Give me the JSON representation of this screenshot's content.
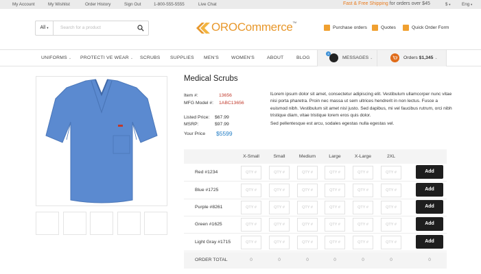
{
  "topbar": {
    "links": [
      "My Account",
      "My Wishlist",
      "Order History",
      "Sign Out",
      "1-800-555-5555",
      "Live Chat"
    ],
    "shipping_highlight": "Fast & Free Shipping",
    "shipping_rest": "for orders over $45",
    "currency": "$",
    "language": "Eng"
  },
  "header": {
    "search_scope": "All",
    "search_placeholder": "Search for a product",
    "logo_oro": "ORO",
    "logo_commerce": "Commerce",
    "logo_tm": "TM",
    "links": [
      "Purchase orders",
      "Quotes",
      "Quick Order Form"
    ]
  },
  "nav": {
    "items": [
      "UNIFORMS",
      "PROTECTI VE WEAR",
      "SCRUBS",
      "SUPPLIES",
      "MEN'S",
      "WOMEN'S",
      "ABOUT",
      "BLOG"
    ],
    "messages_label": "MESSAGES",
    "messages_count": "3",
    "orders_label": "Orders",
    "orders_amount": "$1,345"
  },
  "product": {
    "title": "Medical Scrubs",
    "item_label": "Item #:",
    "item_value": "13656",
    "mfg_label": "MFG Model #:",
    "mfg_value": "1ABC13656",
    "listed_label": "Listed Price:",
    "listed_value": "$67.99",
    "msrp_label": "MSRP:",
    "msrp_value": "$97.99",
    "your_label": "Your Price",
    "your_value": "$5599",
    "desc1": "lLorem ipsum dolor sit amet, consectetur adipiscing elit. Vestibulum ullamcorper nunc vitae nisi porta pharetra. Proin nec massa ut sem ultrices hendrerit in non lectus. Fusce a euismod nibh. Vestibulum sit amet nisl justo. Sed dapibus, mi vel faucibus rutrum, orci nibh tristique diam, vitae tristique lorem eros quis dolor.",
    "desc2": "Sed pellentesque est arcu, sodales egestas nulla egestas vel.",
    "shirt_color": "#5b8ad0"
  },
  "grid": {
    "sizes": [
      "X-Small",
      "Small",
      "Medium",
      "Large",
      "X-Large",
      "2XL"
    ],
    "qty_placeholder": "QTY #",
    "add_label": "Add",
    "rows": [
      "Red #1234",
      "Blue #1725",
      "Purple #8261",
      "Green #1625",
      "Light Gray #1715"
    ],
    "total_label": "ORDER TOTAL",
    "totals": [
      "0",
      "0",
      "0",
      "0",
      "0",
      "0",
      "0"
    ]
  }
}
